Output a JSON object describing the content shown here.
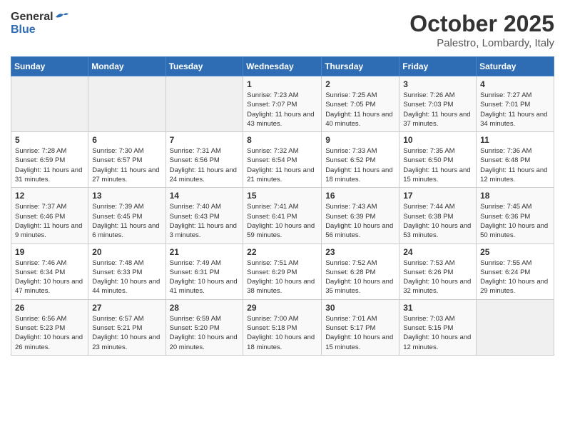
{
  "header": {
    "logo_general": "General",
    "logo_blue": "Blue",
    "month_title": "October 2025",
    "location": "Palestro, Lombardy, Italy"
  },
  "days_of_week": [
    "Sunday",
    "Monday",
    "Tuesday",
    "Wednesday",
    "Thursday",
    "Friday",
    "Saturday"
  ],
  "weeks": [
    {
      "cells": [
        {
          "day": "",
          "empty": true
        },
        {
          "day": "",
          "empty": true
        },
        {
          "day": "",
          "empty": true
        },
        {
          "day": "1",
          "sunrise": "Sunrise: 7:23 AM",
          "sunset": "Sunset: 7:07 PM",
          "daylight": "Daylight: 11 hours and 43 minutes."
        },
        {
          "day": "2",
          "sunrise": "Sunrise: 7:25 AM",
          "sunset": "Sunset: 7:05 PM",
          "daylight": "Daylight: 11 hours and 40 minutes."
        },
        {
          "day": "3",
          "sunrise": "Sunrise: 7:26 AM",
          "sunset": "Sunset: 7:03 PM",
          "daylight": "Daylight: 11 hours and 37 minutes."
        },
        {
          "day": "4",
          "sunrise": "Sunrise: 7:27 AM",
          "sunset": "Sunset: 7:01 PM",
          "daylight": "Daylight: 11 hours and 34 minutes."
        }
      ]
    },
    {
      "cells": [
        {
          "day": "5",
          "sunrise": "Sunrise: 7:28 AM",
          "sunset": "Sunset: 6:59 PM",
          "daylight": "Daylight: 11 hours and 31 minutes."
        },
        {
          "day": "6",
          "sunrise": "Sunrise: 7:30 AM",
          "sunset": "Sunset: 6:57 PM",
          "daylight": "Daylight: 11 hours and 27 minutes."
        },
        {
          "day": "7",
          "sunrise": "Sunrise: 7:31 AM",
          "sunset": "Sunset: 6:56 PM",
          "daylight": "Daylight: 11 hours and 24 minutes."
        },
        {
          "day": "8",
          "sunrise": "Sunrise: 7:32 AM",
          "sunset": "Sunset: 6:54 PM",
          "daylight": "Daylight: 11 hours and 21 minutes."
        },
        {
          "day": "9",
          "sunrise": "Sunrise: 7:33 AM",
          "sunset": "Sunset: 6:52 PM",
          "daylight": "Daylight: 11 hours and 18 minutes."
        },
        {
          "day": "10",
          "sunrise": "Sunrise: 7:35 AM",
          "sunset": "Sunset: 6:50 PM",
          "daylight": "Daylight: 11 hours and 15 minutes."
        },
        {
          "day": "11",
          "sunrise": "Sunrise: 7:36 AM",
          "sunset": "Sunset: 6:48 PM",
          "daylight": "Daylight: 11 hours and 12 minutes."
        }
      ]
    },
    {
      "cells": [
        {
          "day": "12",
          "sunrise": "Sunrise: 7:37 AM",
          "sunset": "Sunset: 6:46 PM",
          "daylight": "Daylight: 11 hours and 9 minutes."
        },
        {
          "day": "13",
          "sunrise": "Sunrise: 7:39 AM",
          "sunset": "Sunset: 6:45 PM",
          "daylight": "Daylight: 11 hours and 6 minutes."
        },
        {
          "day": "14",
          "sunrise": "Sunrise: 7:40 AM",
          "sunset": "Sunset: 6:43 PM",
          "daylight": "Daylight: 11 hours and 3 minutes."
        },
        {
          "day": "15",
          "sunrise": "Sunrise: 7:41 AM",
          "sunset": "Sunset: 6:41 PM",
          "daylight": "Daylight: 10 hours and 59 minutes."
        },
        {
          "day": "16",
          "sunrise": "Sunrise: 7:43 AM",
          "sunset": "Sunset: 6:39 PM",
          "daylight": "Daylight: 10 hours and 56 minutes."
        },
        {
          "day": "17",
          "sunrise": "Sunrise: 7:44 AM",
          "sunset": "Sunset: 6:38 PM",
          "daylight": "Daylight: 10 hours and 53 minutes."
        },
        {
          "day": "18",
          "sunrise": "Sunrise: 7:45 AM",
          "sunset": "Sunset: 6:36 PM",
          "daylight": "Daylight: 10 hours and 50 minutes."
        }
      ]
    },
    {
      "cells": [
        {
          "day": "19",
          "sunrise": "Sunrise: 7:46 AM",
          "sunset": "Sunset: 6:34 PM",
          "daylight": "Daylight: 10 hours and 47 minutes."
        },
        {
          "day": "20",
          "sunrise": "Sunrise: 7:48 AM",
          "sunset": "Sunset: 6:33 PM",
          "daylight": "Daylight: 10 hours and 44 minutes."
        },
        {
          "day": "21",
          "sunrise": "Sunrise: 7:49 AM",
          "sunset": "Sunset: 6:31 PM",
          "daylight": "Daylight: 10 hours and 41 minutes."
        },
        {
          "day": "22",
          "sunrise": "Sunrise: 7:51 AM",
          "sunset": "Sunset: 6:29 PM",
          "daylight": "Daylight: 10 hours and 38 minutes."
        },
        {
          "day": "23",
          "sunrise": "Sunrise: 7:52 AM",
          "sunset": "Sunset: 6:28 PM",
          "daylight": "Daylight: 10 hours and 35 minutes."
        },
        {
          "day": "24",
          "sunrise": "Sunrise: 7:53 AM",
          "sunset": "Sunset: 6:26 PM",
          "daylight": "Daylight: 10 hours and 32 minutes."
        },
        {
          "day": "25",
          "sunrise": "Sunrise: 7:55 AM",
          "sunset": "Sunset: 6:24 PM",
          "daylight": "Daylight: 10 hours and 29 minutes."
        }
      ]
    },
    {
      "cells": [
        {
          "day": "26",
          "sunrise": "Sunrise: 6:56 AM",
          "sunset": "Sunset: 5:23 PM",
          "daylight": "Daylight: 10 hours and 26 minutes."
        },
        {
          "day": "27",
          "sunrise": "Sunrise: 6:57 AM",
          "sunset": "Sunset: 5:21 PM",
          "daylight": "Daylight: 10 hours and 23 minutes."
        },
        {
          "day": "28",
          "sunrise": "Sunrise: 6:59 AM",
          "sunset": "Sunset: 5:20 PM",
          "daylight": "Daylight: 10 hours and 20 minutes."
        },
        {
          "day": "29",
          "sunrise": "Sunrise: 7:00 AM",
          "sunset": "Sunset: 5:18 PM",
          "daylight": "Daylight: 10 hours and 18 minutes."
        },
        {
          "day": "30",
          "sunrise": "Sunrise: 7:01 AM",
          "sunset": "Sunset: 5:17 PM",
          "daylight": "Daylight: 10 hours and 15 minutes."
        },
        {
          "day": "31",
          "sunrise": "Sunrise: 7:03 AM",
          "sunset": "Sunset: 5:15 PM",
          "daylight": "Daylight: 10 hours and 12 minutes."
        },
        {
          "day": "",
          "empty": true
        }
      ]
    }
  ]
}
